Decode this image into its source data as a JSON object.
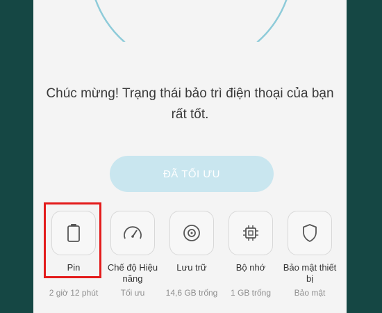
{
  "maintenance": {
    "message_line1": "Chúc mừng! Trạng thái bảo trì điện thoại của bạn",
    "message_line2": "rất tốt.",
    "optimize_button": "ĐÃ TỐI ƯU"
  },
  "features": [
    {
      "label": "Pin",
      "status": "2 giờ 12 phút",
      "icon": "battery-icon"
    },
    {
      "label": "Chế độ Hiệu năng",
      "status": "Tối ưu",
      "icon": "speedometer-icon"
    },
    {
      "label": "Lưu trữ",
      "status": "14,6 GB trống",
      "icon": "storage-disc-icon"
    },
    {
      "label": "Bộ nhớ",
      "status": "1 GB trống",
      "icon": "memory-chip-icon"
    },
    {
      "label": "Bảo mật thiết bị",
      "status": "Bảo mật",
      "icon": "shield-icon"
    }
  ],
  "colors": {
    "background": "#154744",
    "screen": "#f4f4f4",
    "ring": "#8ecbd9",
    "button": "#c9e6ef",
    "highlight": "#e31b1b"
  }
}
